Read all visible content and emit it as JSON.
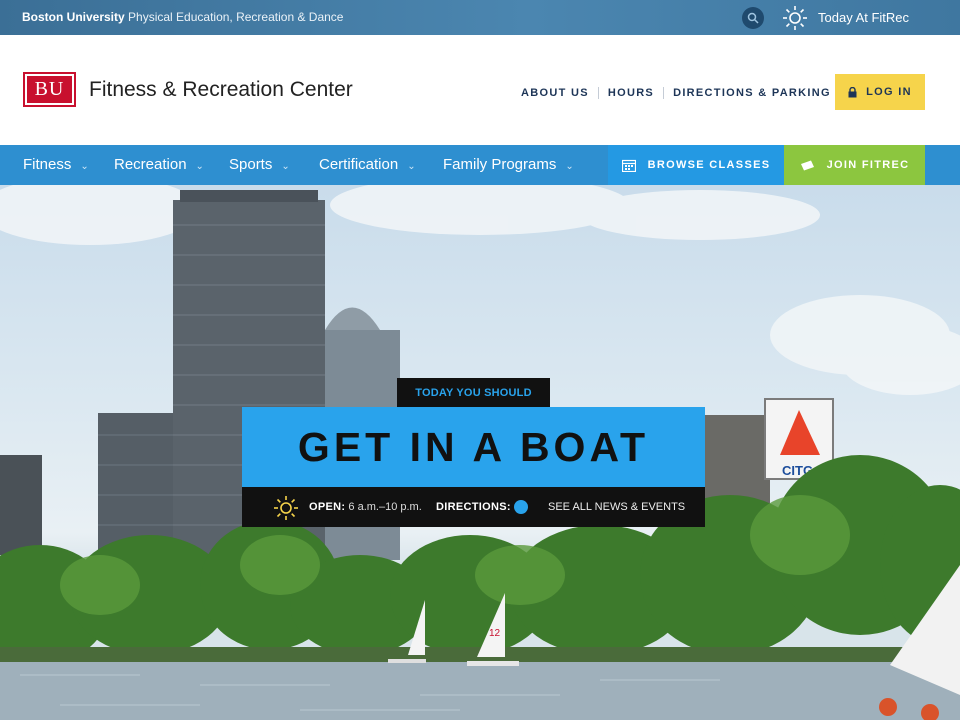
{
  "topbar": {
    "university": "Boston University",
    "department": "Physical Education, Recreation & Dance",
    "today_label": "Today At FitRec",
    "icons": [
      "search-icon",
      "sun-icon"
    ]
  },
  "header": {
    "logo_text": "BU",
    "site_title": "Fitness & Recreation Center",
    "utility_links": [
      "ABOUT US",
      "HOURS",
      "DIRECTIONS & PARKING"
    ],
    "login_label": "LOG IN"
  },
  "mainnav": {
    "items": [
      "Fitness",
      "Recreation",
      "Sports",
      "Certification",
      "Family Programs"
    ],
    "browse_label": "BROWSE CLASSES",
    "join_label": "JOIN FITREC"
  },
  "hero": {
    "tag": "TODAY YOU SHOULD",
    "headline": "GET IN A BOAT",
    "open_label": "OPEN:",
    "open_hours": "6 a.m.–10 p.m.",
    "directions_label": "DIRECTIONS:",
    "news_link": "SEE ALL NEWS & EVENTS",
    "sign_text": "CITG",
    "sail_number": "12"
  },
  "colors": {
    "accent_blue": "#29a3ec",
    "nav_blue": "#2e8fd0",
    "login_yellow": "#f6d44b",
    "join_green": "#8cc63f",
    "bu_red": "#c8102e"
  }
}
